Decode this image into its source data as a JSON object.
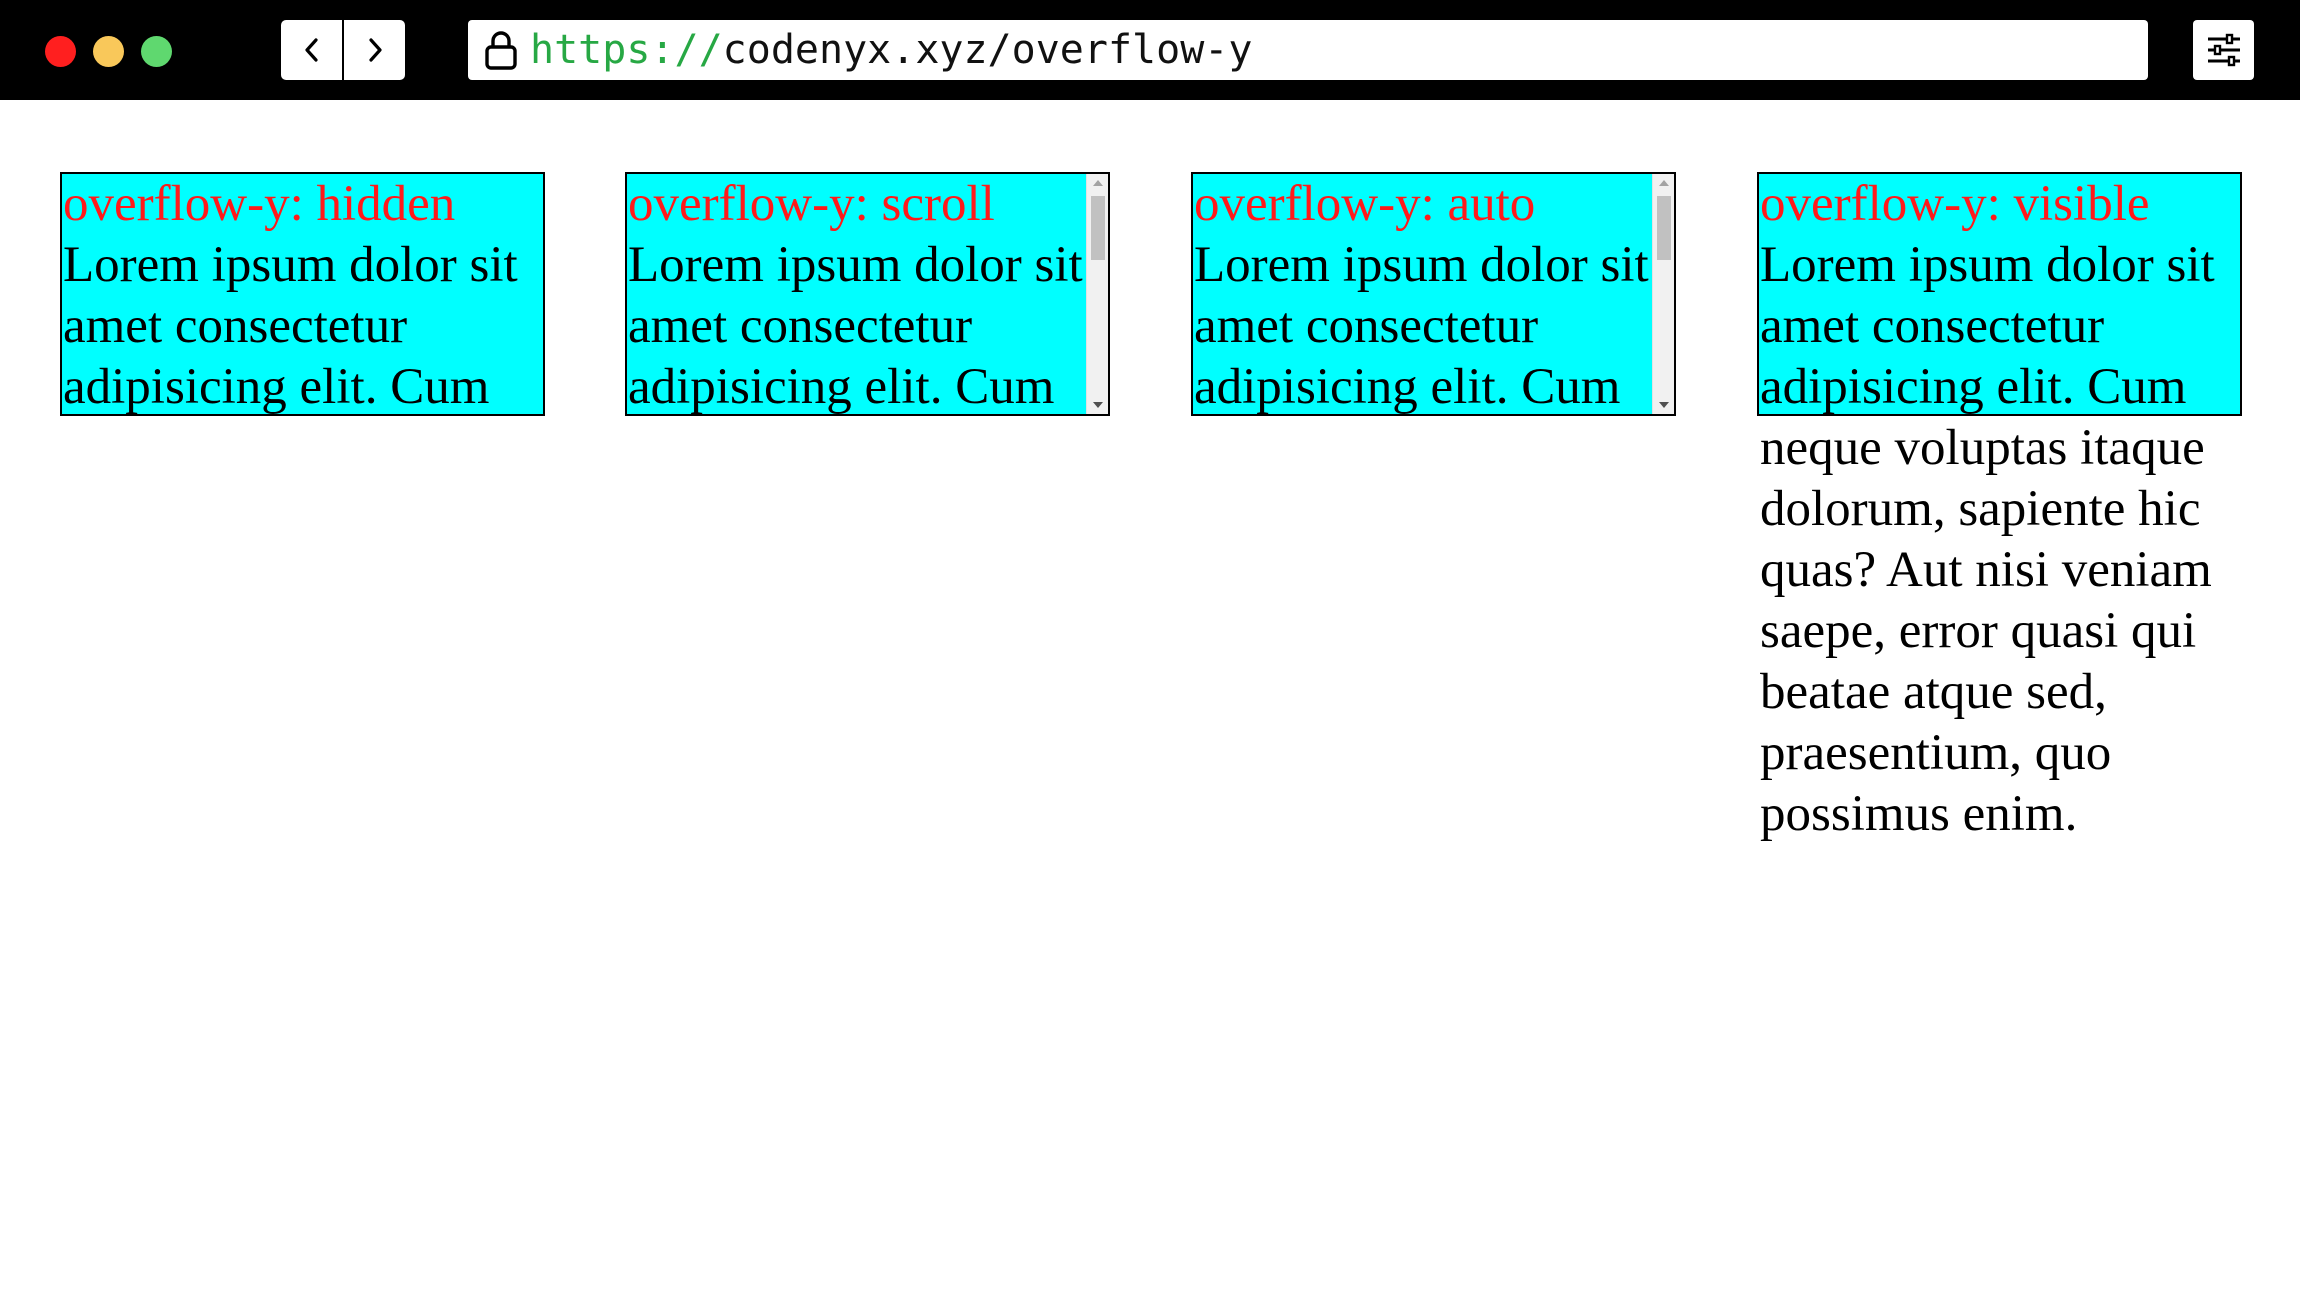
{
  "browser": {
    "url_scheme": "https://",
    "url_rest": "codenyx.xyz/overflow-y"
  },
  "boxes": [
    {
      "title": "overflow-y: hidden",
      "body": "Lorem ipsum dolor sit amet consectetur adipisicing elit. Cum neque voluptas itaque dolorum, sapiente hic quas? Aut nisi veniam saepe, error quasi qui beatae atque sed, praesentium, quo possimus enim."
    },
    {
      "title": "overflow-y: scroll",
      "body": "Lorem ipsum dolor sit amet consectetur adipisicing elit. Cum neque voluptas itaque dolorum, sapiente hic quas? Aut nisi veniam saepe, error quasi qui beatae atque sed, praesentium, quo possimus enim."
    },
    {
      "title": "overflow-y: auto",
      "body": "Lorem ipsum dolor sit amet consectetur adipisicing elit. Cum neque voluptas itaque dolorum, sapiente hic quas? Aut nisi veniam saepe, error quasi qui beatae atque sed, praesentium, quo possimus enim."
    },
    {
      "title": "overflow-y: visible",
      "body": "Lorem ipsum dolor sit amet consectetur adipisicing elit. Cum neque voluptas itaque dolorum, sapiente hic quas? Aut nisi veniam saepe, error quasi qui beatae atque sed, praesentium, quo possimus enim."
    }
  ],
  "colors": {
    "box_background": "#00ffff",
    "title_text": "#ff1a1a",
    "url_scheme": "#27a844",
    "chrome_background": "#000000"
  },
  "icons": {
    "back": "chevron-left-icon",
    "forward": "chevron-right-icon",
    "lock": "lock-icon",
    "menu": "sliders-icon"
  }
}
